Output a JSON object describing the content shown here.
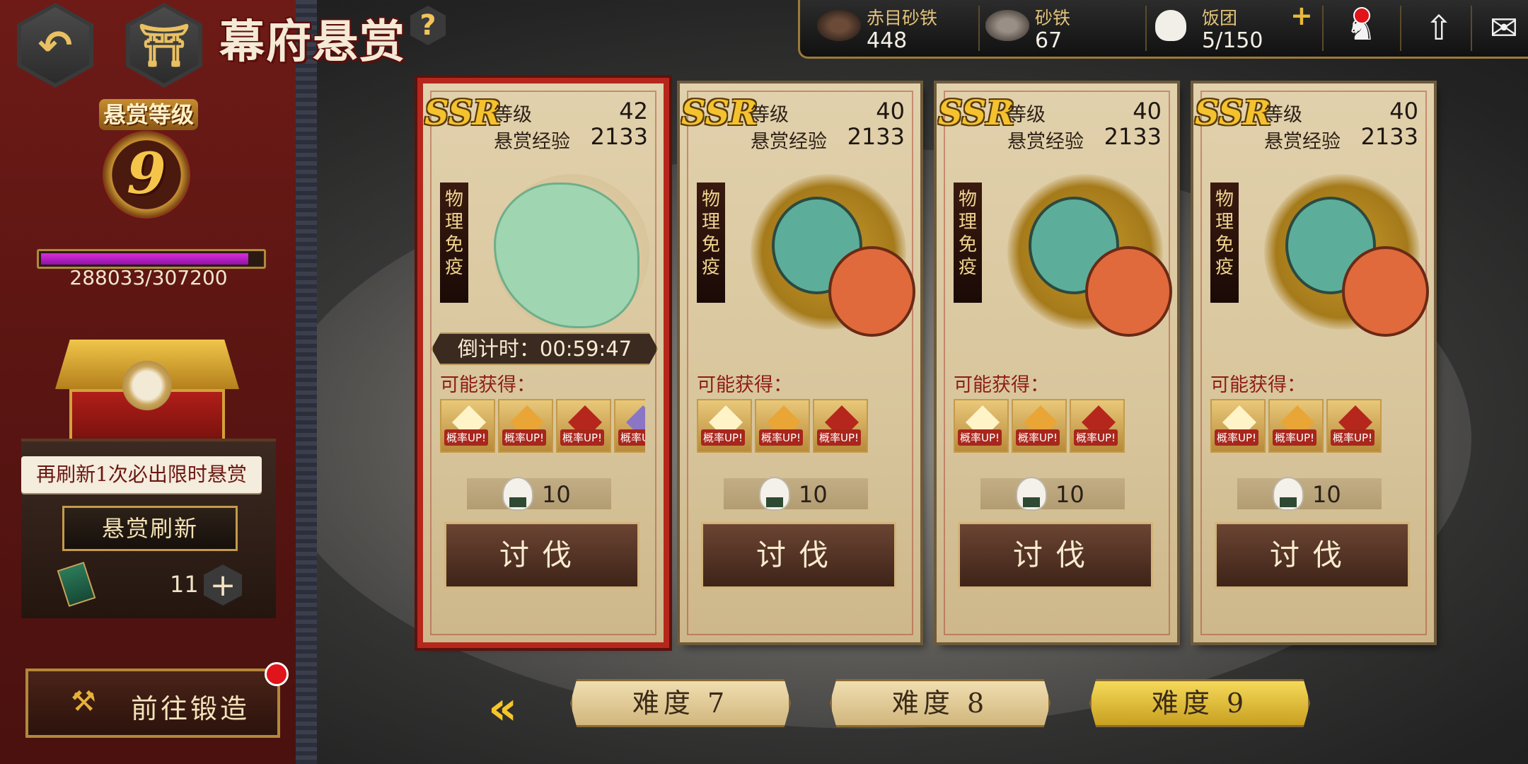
{
  "header": {
    "title": "幕府悬赏",
    "help": "?"
  },
  "resources": [
    {
      "name": "赤目砂铁",
      "value": "448",
      "icon": "red-iron-sand-icon"
    },
    {
      "name": "砂铁",
      "value": "67",
      "icon": "iron-sand-icon"
    },
    {
      "name": "饭团",
      "value": "5/150",
      "icon": "rice-ball-icon",
      "plus": "+"
    }
  ],
  "left": {
    "level_label": "悬赏等级",
    "level": "9",
    "xp_text": "288033/307200",
    "xp_fraction": 0.9376,
    "hint": "再刷新1次必出限时悬赏",
    "refresh_label": "悬赏刷新",
    "ticket_count": "11",
    "plus": "+",
    "forge_label": "前往锻造"
  },
  "cards": [
    {
      "rarity": "SSR",
      "level_label": "等级",
      "level": "42",
      "exp_label": "悬赏经验",
      "exp": "2133",
      "tag": "物理免疫",
      "timer": "倒计时：00:59:47",
      "drops_label": "可能获得：",
      "drops": [
        "概率UP!",
        "概率UP!",
        "概率UP!",
        "概率UP!"
      ],
      "cost": "10",
      "action": "讨伐"
    },
    {
      "rarity": "SSR",
      "level_label": "等级",
      "level": "40",
      "exp_label": "悬赏经验",
      "exp": "2133",
      "tag": "物理免疫",
      "drops_label": "可能获得：",
      "drops": [
        "概率UP!",
        "概率UP!",
        "概率UP!"
      ],
      "cost": "10",
      "action": "讨伐"
    },
    {
      "rarity": "SSR",
      "level_label": "等级",
      "level": "40",
      "exp_label": "悬赏经验",
      "exp": "2133",
      "tag": "物理免疫",
      "drops_label": "可能获得：",
      "drops": [
        "概率UP!",
        "概率UP!",
        "概率UP!"
      ],
      "cost": "10",
      "action": "讨伐"
    },
    {
      "rarity": "SSR",
      "level_label": "等级",
      "level": "40",
      "exp_label": "悬赏经验",
      "exp": "2133",
      "tag": "物理免疫",
      "drops_label": "可能获得：",
      "drops": [
        "概率UP!",
        "概率UP!",
        "概率UP!"
      ],
      "cost": "10",
      "action": "讨伐"
    }
  ],
  "difficulty": [
    {
      "label": "难度 7"
    },
    {
      "label": "难度 8"
    },
    {
      "label": "难度 9",
      "selected": true
    }
  ],
  "colors": {
    "accent": "#b5271c",
    "gold": "#f5c52a",
    "panel": "#6e1b17"
  }
}
